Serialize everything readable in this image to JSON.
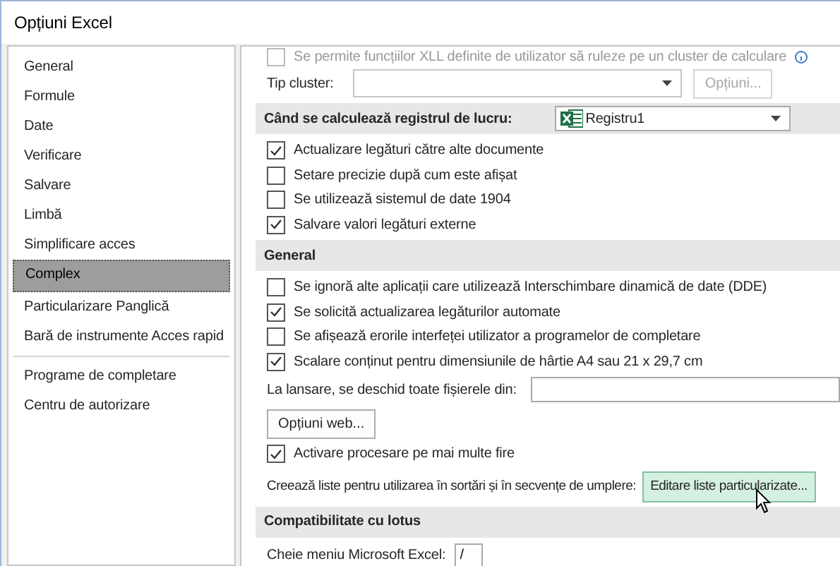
{
  "window": {
    "title": "Opțiuni Excel"
  },
  "sidebar": {
    "groups": [
      [
        {
          "label": "General",
          "selected": false
        },
        {
          "label": "Formule",
          "selected": false
        },
        {
          "label": "Date",
          "selected": false
        },
        {
          "label": "Verificare",
          "selected": false
        },
        {
          "label": "Salvare",
          "selected": false
        },
        {
          "label": "Limbă",
          "selected": false
        },
        {
          "label": "Simplificare acces",
          "selected": false
        },
        {
          "label": "Complex",
          "selected": true
        },
        {
          "label": "Particularizare Panglică",
          "selected": false
        },
        {
          "label": "Bară de instrumente Acces rapid",
          "selected": false
        }
      ],
      [
        {
          "label": "Programe de completare",
          "selected": false
        },
        {
          "label": "Centru de autorizare",
          "selected": false
        }
      ]
    ]
  },
  "panel": [
    {
      "kind": "clipped-checkbox",
      "label": "Se permite funcțiilor XLL definite de utilizator să ruleze pe un cluster de calculare",
      "checked": false
    },
    {
      "kind": "combo",
      "label": "Tip cluster:",
      "button": {
        "label": "Opțiuni...",
        "disabled": true
      }
    },
    {
      "kind": "header",
      "label": "Când se calculează registrul de lucru:",
      "select": "Registru1"
    },
    {
      "kind": "checkbox",
      "label": "Actualizare legături către alte documente",
      "checked": true
    },
    {
      "kind": "checkbox",
      "label": "Setare precizie după cum este afișat",
      "checked": false
    },
    {
      "kind": "checkbox",
      "label": "Se utilizează sistemul de date 1904",
      "checked": false
    },
    {
      "kind": "checkbox",
      "label": "Salvare valori legături externe",
      "checked": true
    },
    {
      "kind": "header",
      "label": "General"
    },
    {
      "kind": "checkbox",
      "label": "Se ignoră alte aplicații care utilizează Interschimbare dinamică de date (DDE)",
      "checked": false
    },
    {
      "kind": "checkbox",
      "label": "Se solicită actualizarea legăturilor automate",
      "checked": true
    },
    {
      "kind": "checkbox",
      "label": "Se afișează erorile interfeței utilizator a programelor de completare",
      "checked": false
    },
    {
      "kind": "checkbox",
      "label": "Scalare conținut pentru dimensiunile de hârtie A4 sau 21 x 29,7 cm",
      "checked": true
    },
    {
      "kind": "text-field",
      "label": "La lansare, se deschid toate fișierele din:"
    },
    {
      "kind": "button",
      "label": "Opțiuni web..."
    },
    {
      "kind": "checkbox",
      "label": "Activare procesare pe mai multe fire",
      "checked": true
    },
    {
      "kind": "button-row",
      "label": "Creează liste pentru utilizarea în sortări și în secvențe de umplere:",
      "button": {
        "label": "Editare liste particularizate...",
        "hover": true
      }
    },
    {
      "kind": "header",
      "label": "Compatibilitate cu lotus"
    },
    {
      "kind": "short-field",
      "label": "Cheie meniu Microsoft Excel:",
      "value": "/"
    }
  ]
}
